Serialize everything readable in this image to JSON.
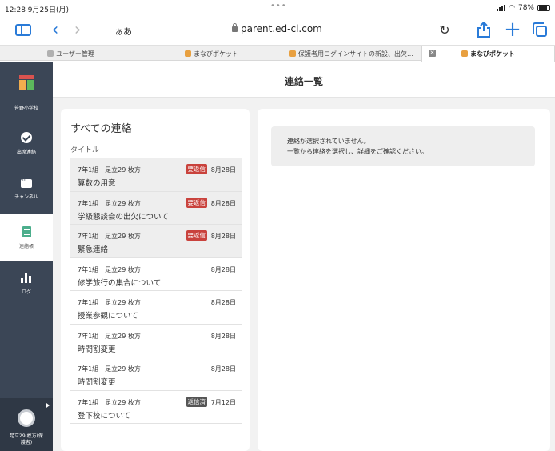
{
  "status_bar": {
    "time": "12:28 9月25日(月)",
    "dots": "•••",
    "battery": "78%"
  },
  "browser": {
    "text_size_label": "ぁあ",
    "url": "parent.ed-cl.com",
    "icons": {
      "sidebar": "sidebar-icon",
      "back": "chevron-left-icon",
      "forward": "chevron-right-icon",
      "reload": "reload-icon",
      "share": "share-icon",
      "new_tab": "plus-icon",
      "tabs": "tabs-icon"
    },
    "tabs": [
      {
        "label": "ユーザー管理",
        "favicon_color": "#b0b0b0",
        "active": false
      },
      {
        "label": "まなびポケット",
        "favicon_color": "#e8a040",
        "active": false
      },
      {
        "label": "保護者用ログインサイトの新設、出欠…",
        "favicon_color": "#e8a040",
        "active": false
      },
      {
        "label": "まなびポケット",
        "favicon_color": "#e8a040",
        "active": true
      }
    ]
  },
  "sidebar": {
    "school_name": "笹野小学校",
    "items": [
      {
        "label": "出席連絡",
        "icon": "check-circle-icon",
        "active": false
      },
      {
        "label": "チャンネル",
        "icon": "chat-icon",
        "active": false
      },
      {
        "label": "連絡帳",
        "icon": "document-icon",
        "active": true
      },
      {
        "label": "ログ",
        "icon": "bar-chart-icon",
        "active": false
      }
    ],
    "user": {
      "name_line1": "足立29 枚方(保",
      "name_line2": "護者)"
    }
  },
  "header": {
    "title": "連絡一覧"
  },
  "list": {
    "heading": "すべての連絡",
    "subheading": "タイトル",
    "messages": [
      {
        "meta": "7年1組　足立29 枚方",
        "subject": "算数の用意",
        "date": "8月28日",
        "badge": "要返信",
        "badge_type": "reply",
        "unread": true
      },
      {
        "meta": "7年1組　足立29 枚方",
        "subject": "学級懇談会の出欠について",
        "date": "8月28日",
        "badge": "要返信",
        "badge_type": "reply",
        "unread": true
      },
      {
        "meta": "7年1組　足立29 枚方",
        "subject": "緊急連絡",
        "date": "8月28日",
        "badge": "要返信",
        "badge_type": "reply",
        "unread": true
      },
      {
        "meta": "7年1組　足立29 枚方",
        "subject": "修学旅行の集合について",
        "date": "8月28日",
        "badge": "",
        "badge_type": "",
        "unread": false
      },
      {
        "meta": "7年1組　足立29 枚方",
        "subject": "授業参観について",
        "date": "8月28日",
        "badge": "",
        "badge_type": "",
        "unread": false
      },
      {
        "meta": "7年1組　足立29 枚方",
        "subject": "時間割変更",
        "date": "8月28日",
        "badge": "",
        "badge_type": "",
        "unread": false
      },
      {
        "meta": "7年1組　足立29 枚方",
        "subject": "時間割変更",
        "date": "8月28日",
        "badge": "",
        "badge_type": "",
        "unread": false
      },
      {
        "meta": "7年1組　足立29 枚方",
        "subject": "登下校について",
        "date": "7月12日",
        "badge": "返信済",
        "badge_type": "done",
        "unread": false
      }
    ]
  },
  "detail": {
    "empty_line1": "連絡が選択されていません。",
    "empty_line2": "一覧から連絡を選択し、詳細をご確認ください。"
  }
}
